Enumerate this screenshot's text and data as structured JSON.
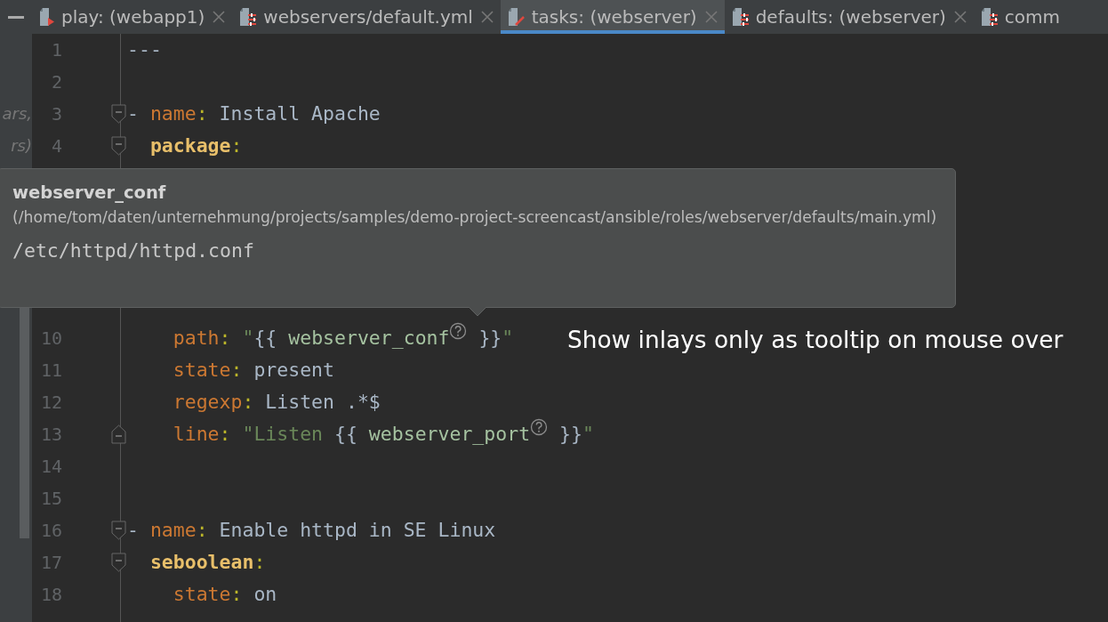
{
  "tabs": [
    {
      "label": "play: (webapp1)",
      "kind": "play",
      "selected": false,
      "close": true
    },
    {
      "label": "webservers/default.yml",
      "kind": "config",
      "selected": false,
      "close": true
    },
    {
      "label": "tasks: (webserver)",
      "kind": "tasks",
      "selected": true,
      "close": true
    },
    {
      "label": "defaults: (webserver)",
      "kind": "config",
      "selected": false,
      "close": true
    },
    {
      "label": "comm",
      "kind": "config",
      "selected": false,
      "close": false
    }
  ],
  "side_panel": {
    "fragments": [
      "ars,",
      "rs)"
    ]
  },
  "code_top": [
    {
      "number": "1",
      "kind": "plain",
      "tokens": [
        {
          "kind": "value",
          "text": "---"
        }
      ]
    },
    {
      "number": "2",
      "kind": "plain"
    },
    {
      "number": "3",
      "kind": "fold-start",
      "tokens": [
        {
          "kind": "dash",
          "text": "- "
        },
        {
          "kind": "key",
          "text": "name"
        },
        {
          "kind": "colon",
          "text": ": "
        },
        {
          "kind": "value",
          "text": "Install Apache"
        }
      ]
    },
    {
      "number": "4",
      "kind": "fold-start",
      "tokens": [
        {
          "kind": "bold-key",
          "text": "  package"
        },
        {
          "kind": "colon",
          "text": ":"
        }
      ]
    }
  ],
  "code_bottom": [
    {
      "number": "10",
      "kind": "plain",
      "tokens": [
        {
          "kind": "key",
          "text": "    path"
        },
        {
          "kind": "colon",
          "text": ": "
        },
        {
          "kind": "string",
          "text": "\""
        },
        {
          "kind": "brace",
          "text": "{{ "
        },
        {
          "kind": "var",
          "text": "webserver_conf"
        },
        {
          "kind": "hint"
        },
        {
          "kind": "brace",
          "text": " }}"
        },
        {
          "kind": "string",
          "text": "\""
        }
      ]
    },
    {
      "number": "11",
      "kind": "plain",
      "tokens": [
        {
          "kind": "key",
          "text": "    state"
        },
        {
          "kind": "colon",
          "text": ": "
        },
        {
          "kind": "value",
          "text": "present"
        }
      ]
    },
    {
      "number": "12",
      "kind": "plain",
      "tokens": [
        {
          "kind": "key",
          "text": "    regexp"
        },
        {
          "kind": "colon",
          "text": ": "
        },
        {
          "kind": "value",
          "text": "Listen .*$"
        }
      ]
    },
    {
      "number": "13",
      "kind": "fold-end",
      "tokens": [
        {
          "kind": "key",
          "text": "    line"
        },
        {
          "kind": "colon",
          "text": ": "
        },
        {
          "kind": "string",
          "text": "\"Listen "
        },
        {
          "kind": "brace",
          "text": "{{ "
        },
        {
          "kind": "var",
          "text": "webserver_port"
        },
        {
          "kind": "hint"
        },
        {
          "kind": "brace",
          "text": " }}"
        },
        {
          "kind": "string",
          "text": "\""
        }
      ]
    },
    {
      "number": "14",
      "kind": "plain"
    },
    {
      "number": "15",
      "kind": "plain"
    },
    {
      "number": "16",
      "kind": "fold-start",
      "tokens": [
        {
          "kind": "dash",
          "text": "- "
        },
        {
          "kind": "key",
          "text": "name"
        },
        {
          "kind": "colon",
          "text": ": "
        },
        {
          "kind": "value",
          "text": "Enable httpd in SE Linux"
        }
      ]
    },
    {
      "number": "17",
      "kind": "fold-start",
      "tokens": [
        {
          "kind": "bold-key",
          "text": "  seboolean"
        },
        {
          "kind": "colon",
          "text": ":"
        }
      ]
    },
    {
      "number": "18",
      "kind": "plain",
      "tokens": [
        {
          "kind": "key",
          "text": "    state"
        },
        {
          "kind": "colon",
          "text": ": "
        },
        {
          "kind": "value",
          "text": "on"
        }
      ]
    }
  ],
  "tooltip": {
    "title": "webserver_conf",
    "path": "(/home/tom/daten/unternehmung/projects/samples/demo-project-screencast/ansible/roles/webserver/defaults/main.yml)",
    "value": "/etc/httpd/httpd.conf"
  },
  "caption": "Show inlays only as tooltip on mouse over"
}
